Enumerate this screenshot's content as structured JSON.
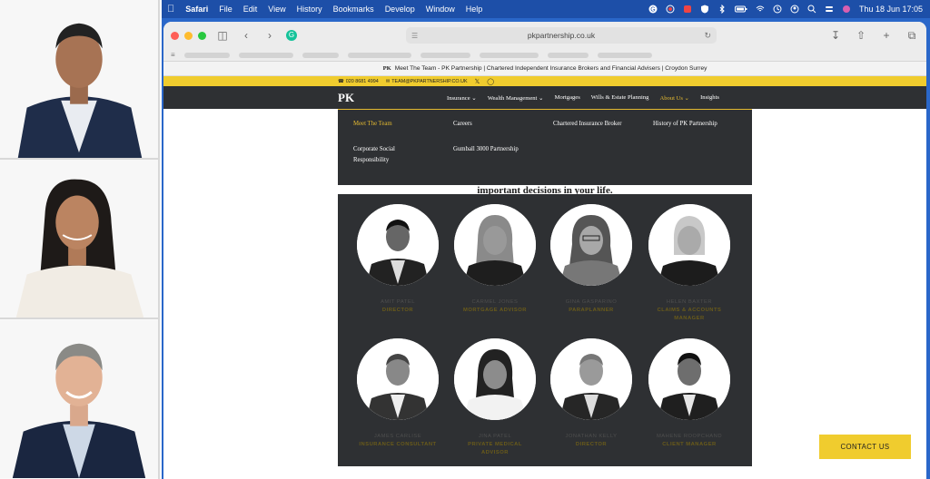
{
  "menubar": {
    "app_name": "Safari",
    "menus": [
      "File",
      "Edit",
      "View",
      "History",
      "Bookmarks",
      "Develop",
      "Window",
      "Help"
    ],
    "datetime": "Thu 18 Jun  17:05",
    "status_icons": [
      "grammarly-icon",
      "record-icon",
      "dropbox-icon",
      "shield-icon",
      "bluetooth-icon",
      "battery-icon",
      "wifi-icon",
      "clock-icon",
      "user-icon",
      "search-icon",
      "control-center-icon",
      "siri-icon"
    ]
  },
  "browser": {
    "url": "pkpartnership.co.uk",
    "tab_title": "Meet The Team - PK Partnership | Chartered Independent Insurance Brokers and Financial Advisers | Croydon Surrey",
    "tab_icon_text": "PK"
  },
  "site": {
    "phone": "020 8681 4994",
    "email": "TEAM@PKPARTNERSHIP.CO.UK",
    "logo": "PK",
    "nav": [
      {
        "label": "Insurance ⌄"
      },
      {
        "label": "Wealth Management ⌄"
      },
      {
        "label": "Mortgages"
      },
      {
        "label": "Wills & Estate Planning"
      },
      {
        "label": "About Us ⌄"
      },
      {
        "label": "Insights"
      }
    ],
    "dropdown": [
      {
        "label": "Meet The Team"
      },
      {
        "label": "Careers"
      },
      {
        "label": "Chartered Insurance Broker"
      },
      {
        "label": "History of PK Partnership"
      },
      {
        "label": "Corporate Social Responsibility"
      },
      {
        "label": "Gumball 3000 Partnership"
      }
    ],
    "tagline": "important decisions in your life.",
    "team": [
      {
        "name": "AMIT PATEL",
        "role": "DIRECTOR"
      },
      {
        "name": "CARMEL JONES",
        "role": "MORTGAGE ADVISOR"
      },
      {
        "name": "GINA GASPARINO",
        "role": "PARAPLANNER"
      },
      {
        "name": "HELEN BAXTER",
        "role": "CLAIMS & ACCOUNTS MANAGER"
      },
      {
        "name": "JAMES CARLISE",
        "role": "INSURANCE CONSULTANT"
      },
      {
        "name": "JINA PATEL",
        "role": "PRIVATE MEDICAL ADVISOR"
      },
      {
        "name": "JONATHAN KELLY",
        "role": "DIRECTOR"
      },
      {
        "name": "MAHENE ROOPCHAND",
        "role": "CLIENT MANAGER"
      }
    ],
    "contact_button": "CONTACT US"
  }
}
